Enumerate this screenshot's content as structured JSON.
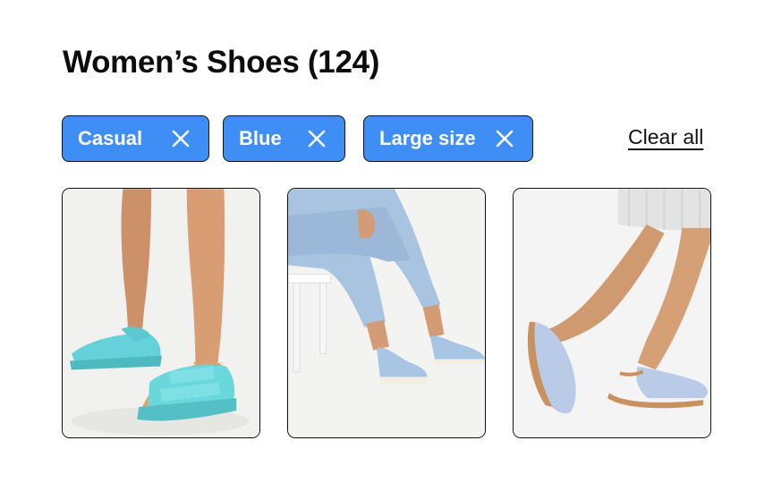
{
  "header": {
    "title": "Women’s Shoes (124)"
  },
  "filters": {
    "chips": [
      {
        "label": "Casual"
      },
      {
        "label": "Blue"
      },
      {
        "label": "Large size"
      }
    ],
    "clear_all_label": "Clear all"
  },
  "products": [
    {
      "image": "blue-quilted-sandals-photo"
    },
    {
      "image": "blue-canvas-espadrilles-photo"
    },
    {
      "image": "blue-slingback-flats-photo"
    }
  ],
  "colors": {
    "chip_bg": "#3f8ef5",
    "border": "#111111",
    "text": "#0c0c0c"
  }
}
